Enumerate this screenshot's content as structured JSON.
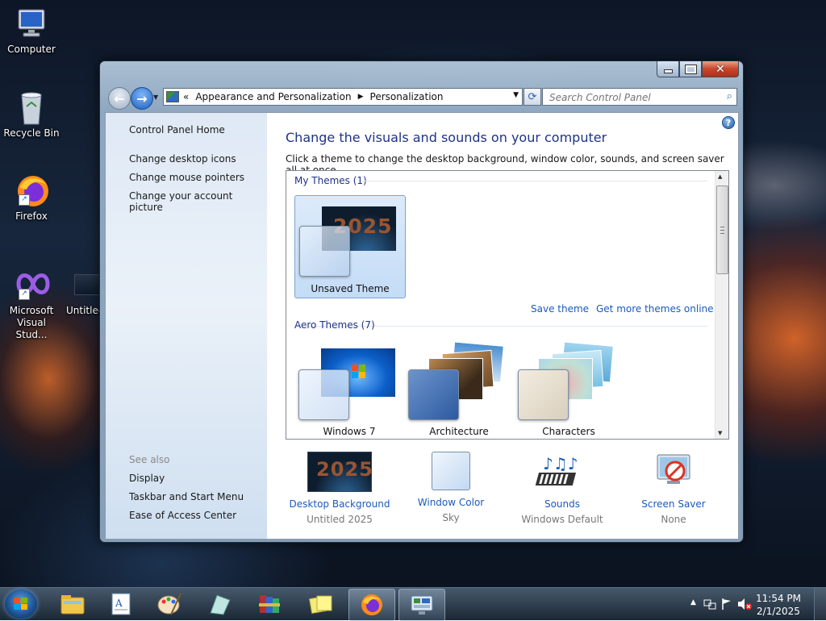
{
  "desktop": {
    "icons": [
      {
        "label": "Computer",
        "icon": "computer-icon"
      },
      {
        "label": "Recycle Bin",
        "icon": "recycle-bin-icon"
      },
      {
        "label": "Firefox",
        "icon": "firefox-icon"
      },
      {
        "label": "Microsoft Visual Stud...",
        "icon": "visual-studio-icon"
      },
      {
        "label": "Untitled",
        "icon": "image-file-icon"
      }
    ]
  },
  "window": {
    "address": {
      "history_glyph": "«",
      "crumbs": [
        "Appearance and Personalization",
        "Personalization"
      ]
    },
    "search_placeholder": "Search Control Panel",
    "sidebar": {
      "home": "Control Panel Home",
      "links": [
        "Change desktop icons",
        "Change mouse pointers",
        "Change your account picture"
      ],
      "see_also_label": "See also",
      "see_also": [
        "Display",
        "Taskbar and Start Menu",
        "Ease of Access Center"
      ]
    },
    "title": "Change the visuals and sounds on your computer",
    "subtitle": "Click a theme to change the desktop background, window color, sounds, and screen saver all at once.",
    "my_themes": {
      "header": "My Themes (1)",
      "tiles": [
        {
          "name": "Unsaved Theme",
          "thumb_text": "2025"
        }
      ],
      "save_link": "Save theme",
      "online_link": "Get more themes online"
    },
    "aero_themes": {
      "header": "Aero Themes (7)",
      "tiles": [
        {
          "name": "Windows 7"
        },
        {
          "name": "Architecture"
        },
        {
          "name": "Characters"
        }
      ]
    },
    "bottom": [
      {
        "label": "Desktop Background",
        "value": "Untitled 2025",
        "thumb_text": "2025"
      },
      {
        "label": "Window Color",
        "value": "Sky"
      },
      {
        "label": "Sounds",
        "value": "Windows Default"
      },
      {
        "label": "Screen Saver",
        "value": "None"
      }
    ]
  },
  "taskbar": {
    "apps": [
      "windows-explorer-icon",
      "wordpad-icon",
      "paint-icon",
      "snipping-tool-icon",
      "winrar-icon",
      "sticky-notes-icon",
      "firefox-icon",
      "control-panel-icon"
    ],
    "clock": {
      "time": "11:54 PM",
      "date": "2/1/2025"
    }
  },
  "colors": {
    "link": "#1a5bbd",
    "title": "#1e3287",
    "selected_tile": "#c4dcf6"
  }
}
